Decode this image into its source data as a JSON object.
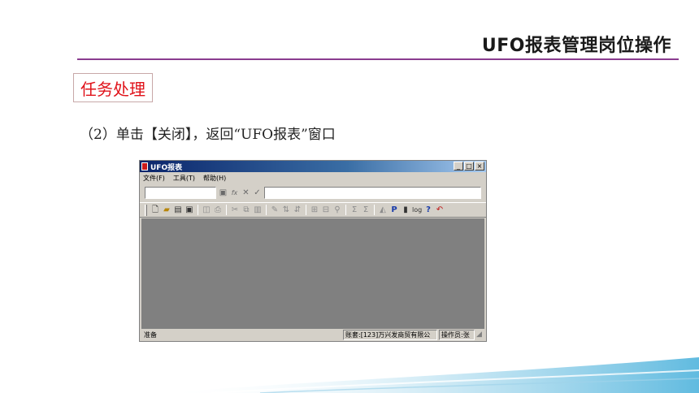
{
  "slide": {
    "title": "UFO报表管理岗位操作",
    "task_label": "任务处理",
    "step_text": "（2）单击【关闭】，返回“UFO报表”窗口",
    "accent_color": "#8a3c8f",
    "task_color": "#e0121a"
  },
  "window": {
    "title": "UFO报表",
    "buttons": {
      "minimize": "_",
      "maximize": "□",
      "close": "×"
    },
    "menu": [
      "文件(F)",
      "工具(T)",
      "帮助(H)"
    ],
    "editbar": {
      "save": "▣",
      "fx": "fx",
      "cancel": "✕",
      "confirm": "✓"
    },
    "toolbar": [
      "new-icon",
      "open-icon",
      "copy-doc-icon",
      "save-icon",
      "print-preview-icon",
      "print-icon",
      "cut-icon",
      "copy-icon",
      "paste-icon",
      "format-painter-icon",
      "sort-asc-icon",
      "sort-desc-icon",
      "table-icon",
      "grid-icon",
      "find-icon",
      "sum-icon",
      "sum-all-icon",
      "chart-icon",
      "bold-p-icon",
      "info-icon",
      "log-icon",
      "help-icon",
      "undo-icon"
    ],
    "status": {
      "ready": "准备",
      "account": "账套:[123]万兴发商贸有限公",
      "operator": "操作员:张"
    }
  }
}
